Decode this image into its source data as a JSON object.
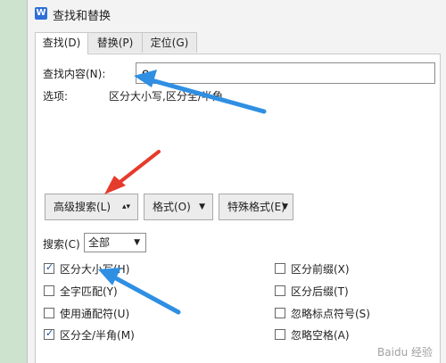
{
  "dialog": {
    "title": "查找和替换",
    "app_icon": "W",
    "tabs": [
      {
        "label": "查找(D)",
        "active": true
      },
      {
        "label": "替换(P)",
        "active": false
      },
      {
        "label": "定位(G)",
        "active": false
      }
    ]
  },
  "find": {
    "label": "查找内容(N):",
    "value": "e",
    "options_label": "选项:",
    "options_value": "区分大小写,区分全/半角"
  },
  "buttons": {
    "advanced": "高级搜索(L)",
    "format": "格式(O)",
    "special": "特殊格式(E)"
  },
  "search": {
    "label": "搜索(C)",
    "selected": "全部"
  },
  "options": {
    "left": [
      {
        "label": "区分大小写(H)",
        "checked": true
      },
      {
        "label": "全字匹配(Y)",
        "checked": false
      },
      {
        "label": "使用通配符(U)",
        "checked": false
      },
      {
        "label": "区分全/半角(M)",
        "checked": true
      }
    ],
    "right": [
      {
        "label": "区分前缀(X)",
        "checked": false
      },
      {
        "label": "区分后缀(T)",
        "checked": false
      },
      {
        "label": "忽略标点符号(S)",
        "checked": false
      },
      {
        "label": "忽略空格(A)",
        "checked": false
      }
    ]
  },
  "watermark": "Baidu 经验",
  "colors": {
    "annotation_blue": "#2f8fe3",
    "annotation_red": "#e53b2c"
  }
}
